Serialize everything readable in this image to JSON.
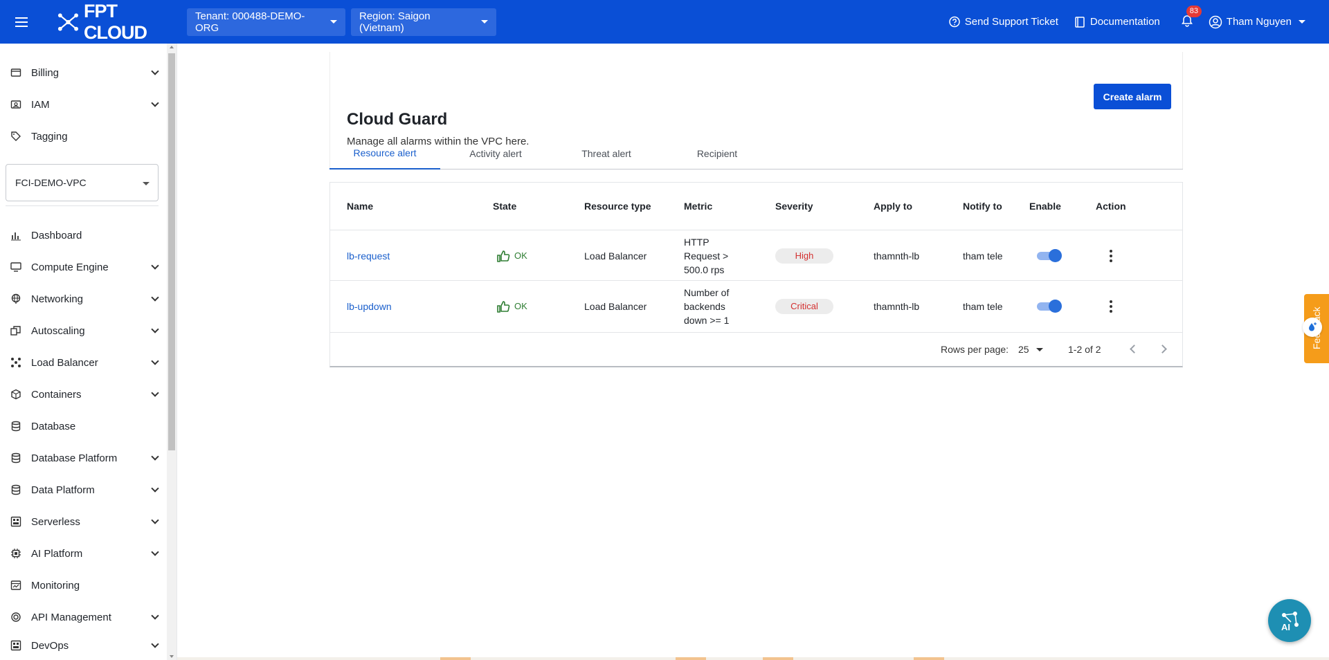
{
  "header": {
    "brand": "FPT CLOUD",
    "tenant": "Tenant: 000488-DEMO-ORG",
    "region": "Region: Saigon (Vietnam)",
    "support": "Send Support Ticket",
    "docs": "Documentation",
    "notification_count": "83",
    "user": "Tham Nguyen",
    "bar_color": "#0a4fd6"
  },
  "sidebar": {
    "top_items": [
      {
        "label": "Billing",
        "icon": "billing-icon",
        "expandable": true
      },
      {
        "label": "IAM",
        "icon": "iam-icon",
        "expandable": true
      },
      {
        "label": "Tagging",
        "icon": "tag-icon",
        "expandable": false
      }
    ],
    "vpc": "FCI-DEMO-VPC",
    "items": [
      {
        "label": "Dashboard",
        "icon": "bar-chart-icon",
        "expandable": false
      },
      {
        "label": "Compute Engine",
        "icon": "monitor-icon",
        "expandable": true
      },
      {
        "label": "Networking",
        "icon": "globe-icon",
        "expandable": true
      },
      {
        "label": "Autoscaling",
        "icon": "autoscaling-icon",
        "expandable": true
      },
      {
        "label": "Load Balancer",
        "icon": "load-balancer-icon",
        "expandable": true
      },
      {
        "label": "Containers",
        "icon": "cube-icon",
        "expandable": true
      },
      {
        "label": "Database",
        "icon": "database-icon",
        "expandable": false
      },
      {
        "label": "Database Platform",
        "icon": "database-icon",
        "expandable": true
      },
      {
        "label": "Data Platform",
        "icon": "database-icon",
        "expandable": true
      },
      {
        "label": "Serverless",
        "icon": "serverless-icon",
        "expandable": true
      },
      {
        "label": "AI Platform",
        "icon": "chip-icon",
        "expandable": true
      },
      {
        "label": "Monitoring",
        "icon": "monitoring-icon",
        "expandable": false
      },
      {
        "label": "API Management",
        "icon": "api-icon",
        "expandable": true
      },
      {
        "label": "DevOps",
        "icon": "devops-icon",
        "expandable": true
      }
    ]
  },
  "page": {
    "title": "Cloud Guard",
    "subtitle": "Manage all alarms within the VPC here.",
    "create_button": "Create alarm",
    "tabs": [
      "Resource alert",
      "Activity alert",
      "Threat alert",
      "Recipient"
    ],
    "active_tab": "Resource alert"
  },
  "table": {
    "columns": [
      "Name",
      "State",
      "Resource type",
      "Metric",
      "Severity",
      "Apply to",
      "Notify to",
      "Enable",
      "Action"
    ],
    "rows": [
      {
        "name": "lb-request",
        "state": "OK",
        "resource_type": "Load Balancer",
        "metric": "HTTP Request > 500.0 rps",
        "severity": "High",
        "apply_to": "thamnth-lb",
        "notify_to": "tham tele",
        "enabled": true
      },
      {
        "name": "lb-updown",
        "state": "OK",
        "resource_type": "Load Balancer",
        "metric": "Number of backends down >= 1",
        "severity": "Critical",
        "apply_to": "thamnth-lb",
        "notify_to": "tham tele",
        "enabled": true
      }
    ],
    "pagination": {
      "rows_per_page_label": "Rows per page:",
      "rows_per_page": "25",
      "range": "1-2 of 2"
    }
  },
  "feedback": "Feedback"
}
